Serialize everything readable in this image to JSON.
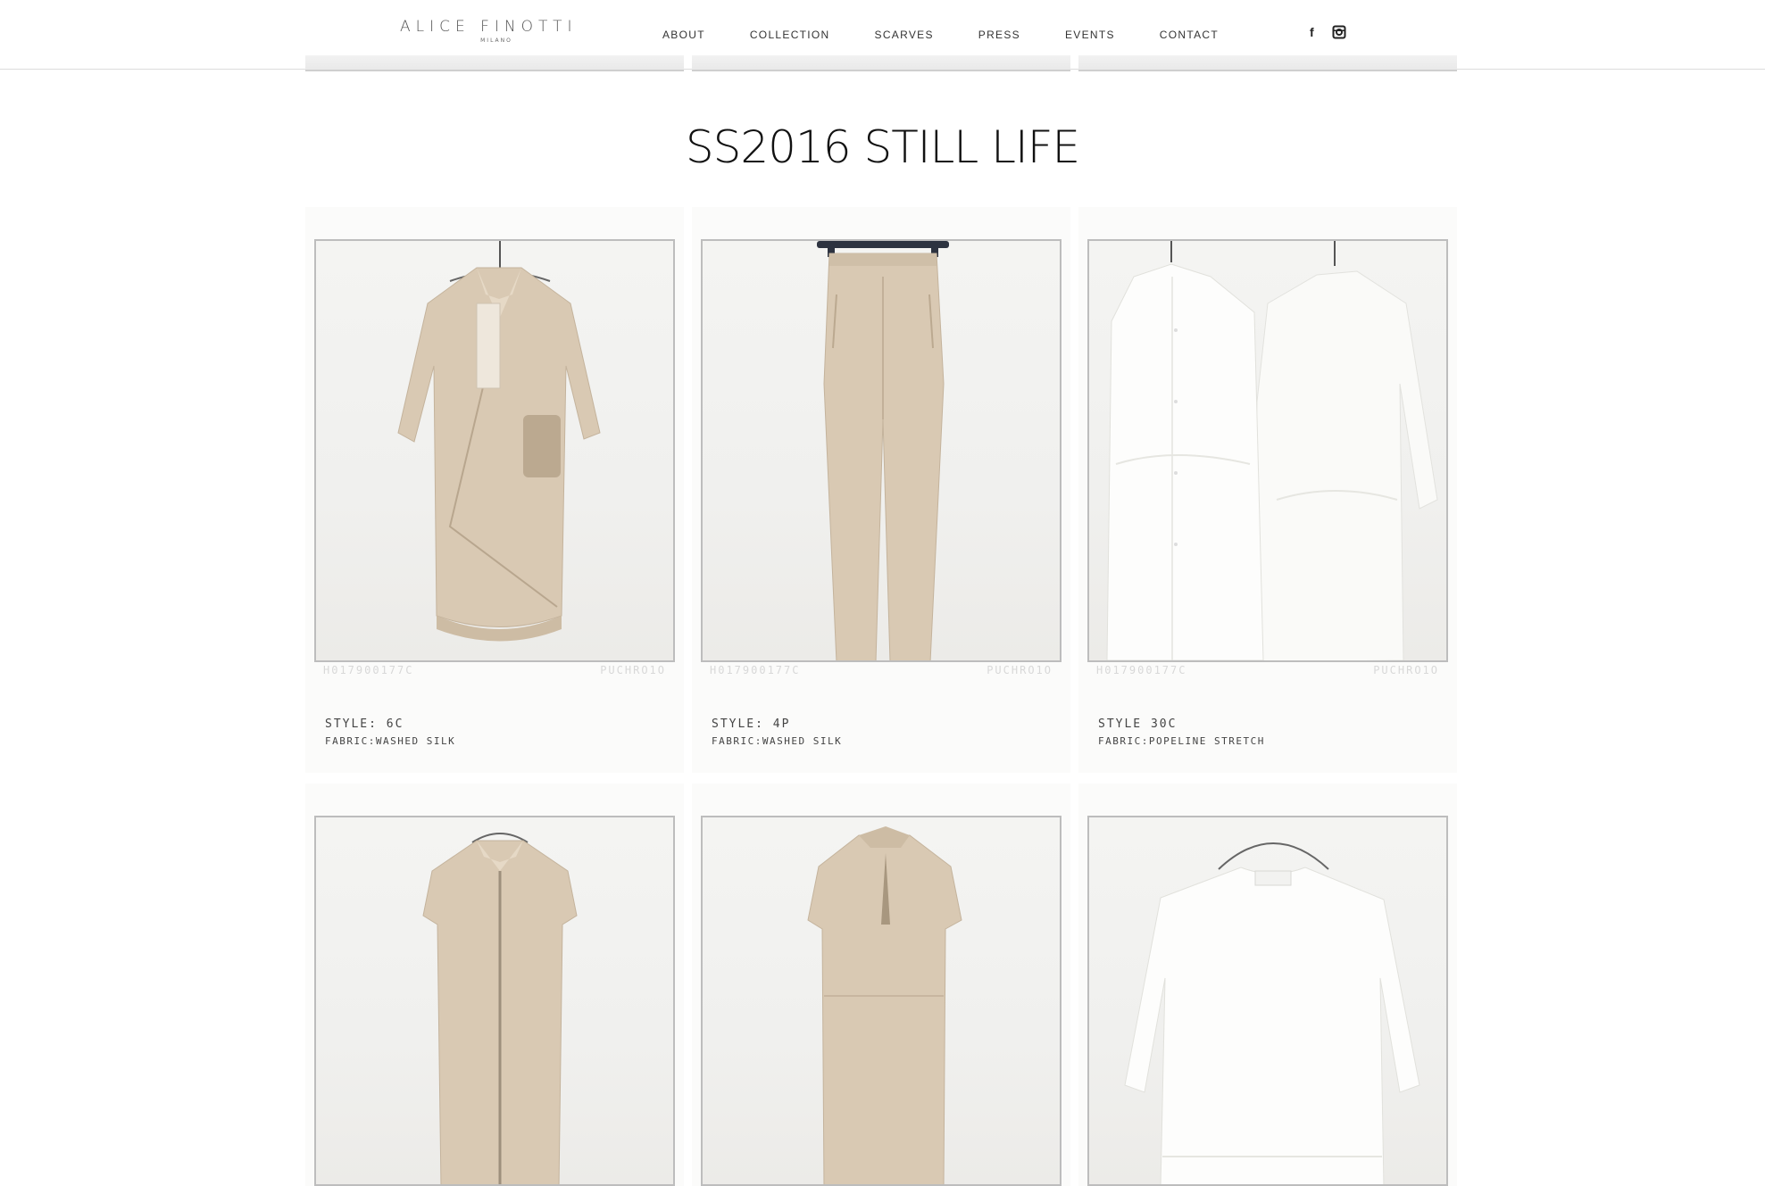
{
  "header": {
    "logo": {
      "name": "ALICE FINOTTI",
      "sub": "MILANO"
    },
    "nav": [
      "ABOUT",
      "COLLECTION",
      "SCARVES",
      "PRESS",
      "EVENTS",
      "CONTACT"
    ],
    "social": [
      "facebook-icon",
      "instagram-icon"
    ],
    "facebook_glyph": "f"
  },
  "page": {
    "title": "SS2016 STILL LIFE"
  },
  "gallery": {
    "items": [
      {
        "garment": "beige-wrap-shirt",
        "style": "STYLE: 6C",
        "fabric": "FABRIC:WASHED SILK",
        "film_left": "H017900177C",
        "film_right": "PUCHRO1O"
      },
      {
        "garment": "beige-trousers",
        "style": "STYLE: 4P",
        "fabric": "FABRIC:WASHED SILK",
        "film_left": "H017900177C",
        "film_right": "PUCHRO1O"
      },
      {
        "garment": "white-shirts",
        "style": "STYLE 30C",
        "fabric": "FABRIC:POPELINE STRETCH",
        "film_left": "H017900177C",
        "film_right": "PUCHRO1O"
      },
      {
        "garment": "beige-sleeveless-shirt-front",
        "style": "",
        "fabric": "",
        "film_left": "",
        "film_right": ""
      },
      {
        "garment": "beige-sleeveless-shirt-back",
        "style": "",
        "fabric": "",
        "film_left": "",
        "film_right": ""
      },
      {
        "garment": "white-top",
        "style": "",
        "fabric": "",
        "film_left": "",
        "film_right": ""
      }
    ]
  },
  "colors": {
    "beige": "#d9c9b3",
    "white_garment": "#fbfbf9",
    "border": "#bdbdbd",
    "text": "#222222"
  }
}
